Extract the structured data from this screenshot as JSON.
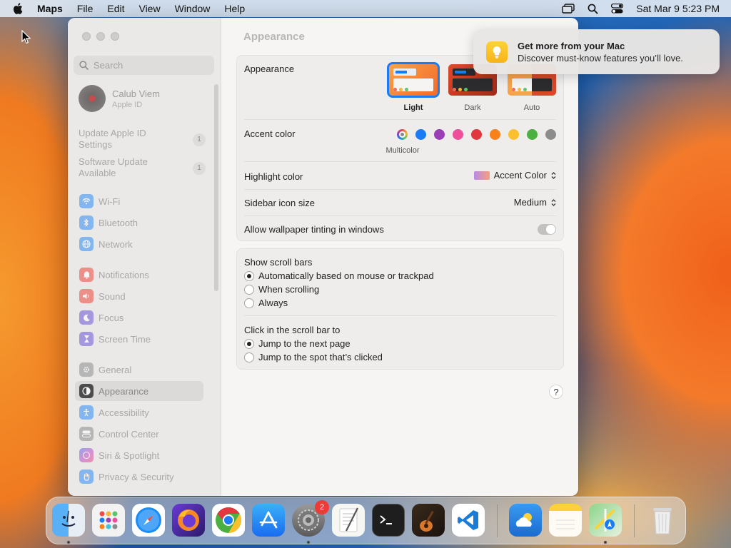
{
  "menubar": {
    "app": "Maps",
    "items": [
      "File",
      "Edit",
      "View",
      "Window",
      "Help"
    ],
    "datetime": "Sat Mar 9  5:23 PM"
  },
  "sidebar": {
    "search_placeholder": "Search",
    "profile": {
      "name": "Calub Viem",
      "subtitle": "Apple ID"
    },
    "notices": [
      {
        "label": "Update Apple ID Settings",
        "count": "1"
      },
      {
        "label": "Software Update Available",
        "count": "1"
      }
    ],
    "items": [
      {
        "label": "Wi-Fi",
        "icon": "wifi-icon",
        "color": "#2f8cf6"
      },
      {
        "label": "Bluetooth",
        "icon": "bluetooth-icon",
        "color": "#2f8cf6"
      },
      {
        "label": "Network",
        "icon": "globe-icon",
        "color": "#2f8cf6"
      },
      {
        "label": "Notifications",
        "icon": "bell-icon",
        "color": "#f0463c"
      },
      {
        "label": "Sound",
        "icon": "speaker-icon",
        "color": "#f0463c"
      },
      {
        "label": "Focus",
        "icon": "moon-icon",
        "color": "#6b55d6"
      },
      {
        "label": "Screen Time",
        "icon": "hourglass-icon",
        "color": "#6b55d6"
      },
      {
        "label": "General",
        "icon": "gear-icon",
        "color": "#8e8e8e"
      },
      {
        "label": "Appearance",
        "icon": "appearance-icon",
        "color": "#1d1d1f"
      },
      {
        "label": "Accessibility",
        "icon": "accessibility-icon",
        "color": "#2f8cf6"
      },
      {
        "label": "Control Center",
        "icon": "control-center-icon",
        "color": "#8e8e8e"
      },
      {
        "label": "Siri & Spotlight",
        "icon": "siri-icon",
        "color": "#c04ac8"
      },
      {
        "label": "Privacy & Security",
        "icon": "hand-icon",
        "color": "#2f8cf6"
      }
    ],
    "selected": "Appearance"
  },
  "content": {
    "title": "Appearance",
    "appearance": {
      "label": "Appearance",
      "options": [
        {
          "label": "Light",
          "selected": true
        },
        {
          "label": "Dark",
          "selected": false
        },
        {
          "label": "Auto",
          "selected": false
        }
      ]
    },
    "accent": {
      "label": "Accent color",
      "selected_name": "Multicolor",
      "colors": [
        "multicolor",
        "#1a7cf4",
        "#9a3fb5",
        "#ef4e9a",
        "#e0383e",
        "#f7821b",
        "#fbc02d",
        "#4caf42",
        "#8c8c8c"
      ]
    },
    "highlight": {
      "label": "Highlight color",
      "value": "Accent Color"
    },
    "icon_size": {
      "label": "Sidebar icon size",
      "value": "Medium"
    },
    "tinting": {
      "label": "Allow wallpaper tinting in windows",
      "on": false
    },
    "scroll_bars": {
      "label": "Show scroll bars",
      "options": [
        {
          "label": "Automatically based on mouse or trackpad",
          "selected": true
        },
        {
          "label": "When scrolling",
          "selected": false
        },
        {
          "label": "Always",
          "selected": false
        }
      ]
    },
    "click_scroll": {
      "label": "Click in the scroll bar to",
      "options": [
        {
          "label": "Jump to the next page",
          "selected": true
        },
        {
          "label": "Jump to the spot that’s clicked",
          "selected": false
        }
      ]
    },
    "help": "?"
  },
  "notification": {
    "title": "Get more from your Mac",
    "body": "Discover must-know features you’ll love."
  },
  "dock": {
    "apps": [
      {
        "name": "finder",
        "running": true
      },
      {
        "name": "launchpad",
        "running": false
      },
      {
        "name": "safari",
        "running": false
      },
      {
        "name": "firefox",
        "running": false
      },
      {
        "name": "chrome",
        "running": false
      },
      {
        "name": "app-store",
        "running": false
      },
      {
        "name": "system-settings",
        "running": true,
        "badge": "2"
      },
      {
        "name": "textedit",
        "running": false
      },
      {
        "name": "terminal",
        "running": false
      },
      {
        "name": "garageband",
        "running": false
      },
      {
        "name": "vscode",
        "running": false
      },
      {
        "name": "weather",
        "running": false
      },
      {
        "name": "notes",
        "running": false
      },
      {
        "name": "maps",
        "running": true
      },
      {
        "name": "trash",
        "running": false
      }
    ]
  }
}
